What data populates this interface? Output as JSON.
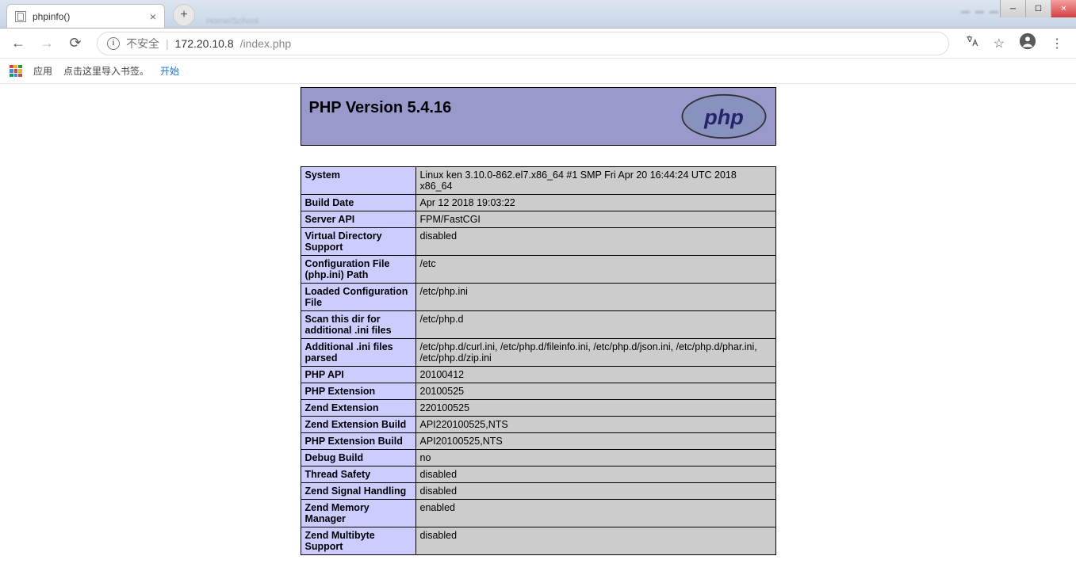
{
  "tab": {
    "title": "phpinfo()"
  },
  "ghost_tab_hint": "Home/School",
  "address": {
    "insecure_label": "不安全",
    "host": "172.20.10.8",
    "path": "/index.php"
  },
  "bookmarks": {
    "apps_label": "应用",
    "hint": "点击这里导入书签。",
    "start_label": "开始"
  },
  "php": {
    "header_title": "PHP Version 5.4.16",
    "rows": [
      {
        "k": "System",
        "v": "Linux ken 3.10.0-862.el7.x86_64 #1 SMP Fri Apr 20 16:44:24 UTC 2018 x86_64"
      },
      {
        "k": "Build Date",
        "v": "Apr 12 2018 19:03:22"
      },
      {
        "k": "Server API",
        "v": "FPM/FastCGI"
      },
      {
        "k": "Virtual Directory Support",
        "v": "disabled"
      },
      {
        "k": "Configuration File (php.ini) Path",
        "v": "/etc"
      },
      {
        "k": "Loaded Configuration File",
        "v": "/etc/php.ini"
      },
      {
        "k": "Scan this dir for additional .ini files",
        "v": "/etc/php.d"
      },
      {
        "k": "Additional .ini files parsed",
        "v": "/etc/php.d/curl.ini, /etc/php.d/fileinfo.ini, /etc/php.d/json.ini, /etc/php.d/phar.ini, /etc/php.d/zip.ini"
      },
      {
        "k": "PHP API",
        "v": "20100412"
      },
      {
        "k": "PHP Extension",
        "v": "20100525"
      },
      {
        "k": "Zend Extension",
        "v": "220100525"
      },
      {
        "k": "Zend Extension Build",
        "v": "API220100525,NTS"
      },
      {
        "k": "PHP Extension Build",
        "v": "API20100525,NTS"
      },
      {
        "k": "Debug Build",
        "v": "no"
      },
      {
        "k": "Thread Safety",
        "v": "disabled"
      },
      {
        "k": "Zend Signal Handling",
        "v": "disabled"
      },
      {
        "k": "Zend Memory Manager",
        "v": "enabled"
      },
      {
        "k": "Zend Multibyte Support",
        "v": "disabled"
      }
    ]
  }
}
